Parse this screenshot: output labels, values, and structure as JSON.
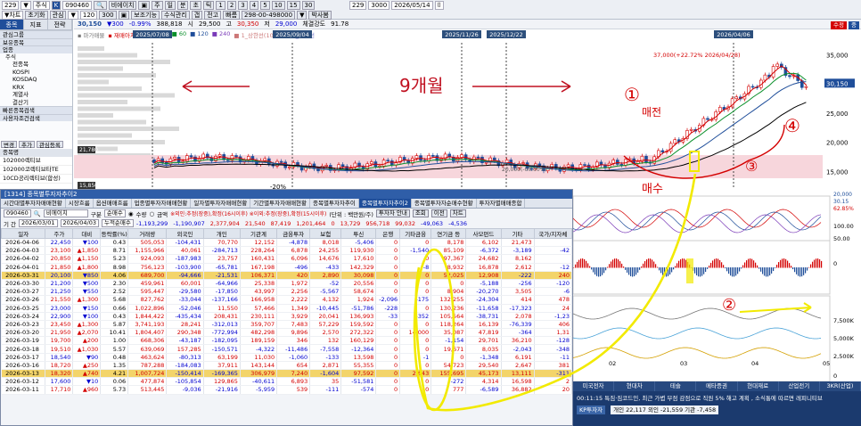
{
  "toolbar": {
    "row1": [
      "229",
      "▼",
      "주식",
      "K",
      "090460",
      "🔍",
      "비에이치",
      "▣",
      "주",
      "일",
      "분",
      "초",
      "틱",
      "1",
      "2",
      "3",
      "4",
      "5",
      "10",
      "15",
      "30"
    ],
    "row1b": [
      "229",
      "3000",
      "2026/05/14",
      "⌷"
    ],
    "row2": [
      "▼차트",
      "초기화",
      "관심",
      "▼",
      "120",
      "300",
      "▣",
      "보조기능",
      "수식관리",
      "갭",
      "전고",
      "빠름",
      "298-00-498000",
      "▼",
      "박사봄"
    ]
  },
  "sidebar": {
    "tabs": [
      "종목",
      "지표",
      "전략"
    ],
    "items": [
      {
        "label": "관심그룹",
        "type": "sect"
      },
      {
        "label": "보유종목",
        "type": "sect"
      },
      {
        "label": "업종",
        "type": "sect"
      },
      {
        "label": "주식",
        "type": "item"
      },
      {
        "label": "전종목",
        "type": "sub"
      },
      {
        "label": "KOSPI",
        "type": "sub"
      },
      {
        "label": "KOSDAQ",
        "type": "sub"
      },
      {
        "label": "KRX",
        "type": "sub"
      },
      {
        "label": "계열사",
        "type": "sub"
      },
      {
        "label": "결산기",
        "type": "sub"
      },
      {
        "label": "빠른종목검색",
        "type": "sect"
      },
      {
        "label": "사용자조건검색",
        "type": "sect"
      }
    ]
  },
  "stock_panel": {
    "buttons": [
      "변경",
      "추가",
      "관심등록"
    ],
    "header": "종목명",
    "items": [
      "102000렉티브",
      "102000코렉티브타TE",
      "10CD공리렉티브(합성)"
    ]
  },
  "chart_header": {
    "items": [
      "▪ 마가매물",
      "▪ 재매아치",
      "▣ 5",
      "■ 20",
      "■ 60",
      "■ 120",
      "■ 240",
      "■ 1_상한선(10.3)",
      "■ 1_하한선"
    ],
    "price": "30,150",
    "chg": "▼300",
    "pct": "-0.99%",
    "vol": "388,818",
    "hi_label": "고",
    "hi": "30,350",
    "lo_label": "저",
    "lo": "29,000",
    "amt_label": "체결강도",
    "amt": "91.78",
    "open_label": "시",
    "open": "29,500"
  },
  "chart_labels": {
    "dates": [
      "2025/07/08",
      "2025/09/04",
      "2025/11/26",
      "2025/12/22",
      "2026/04/06"
    ],
    "yaxis": [
      "35,000",
      "30,150",
      "25,000",
      "20,000",
      "15,000"
    ],
    "annot_top": "37,000(+22.72% 2026/04/28)",
    "annot_mid": "20,000(-00.00%)",
    "annot_left": "21,780",
    "annot_left2": "15,850",
    "annot_20": "-20%",
    "right_buttons": [
      "수정",
      "중"
    ]
  },
  "handwriting": {
    "months": "9개월",
    "n1": "①",
    "word1": "매전",
    "n4": "④",
    "n3": "③",
    "buy": "매수",
    "n2": "②"
  },
  "window": {
    "title": "[1314] 종목별투자자추이2",
    "tabs": [
      "시간대별투자자매매현황",
      "시장흐름",
      "옵션매매흐름",
      "업종별투자자매매현황",
      "일자별투자자매매현황",
      "기간별투자자매매현황",
      "종목별투자자추이",
      "종목별투자자추이2",
      "종목별투자자순매수현황",
      "투자자별매매종합"
    ],
    "ctrl1": {
      "code": "090460",
      "name": "비에이치",
      "kind_label": "구분",
      "kind": "순매수",
      "unit_toggle": "수량",
      "amount_toggle": "금액",
      "note": "※외인:추정(장중),확정(16시이후)  ※이외:추정(장중),확정(15시이후)",
      "unit_label": "(단위 : 백만원/주)",
      "btn1": "투자자 안내",
      "btn2": "조회",
      "btn3": "이전",
      "btn4": "차트"
    },
    "ctrl2": {
      "period_label": "기 간",
      "from": "2026/03/01",
      "to": "2026/04/03",
      "accum_label": "누적순매수",
      "sums": [
        "-1,193,299",
        "-1,190,907",
        "2,377,904",
        "21,540",
        "87,419",
        "1,201,464",
        "0",
        "13,729",
        "956,718",
        "99,032",
        "-49,063",
        "-4,536"
      ]
    },
    "columns": [
      "일자",
      "주가",
      "대비",
      "등락률(%)",
      "거래량",
      "외국인",
      "개인",
      "기관계",
      "금융투자",
      "보험",
      "투신",
      "은행",
      "기타금융",
      "연기금 등",
      "사모펀드",
      "기타",
      "국가/지자체"
    ],
    "rows": [
      [
        "2026-04-06",
        "22,450",
        "▼100",
        "0.43",
        "505,053",
        "-104,431",
        "70,770",
        "12,152",
        "-4,878",
        "8,018",
        "-5,406",
        "0",
        "0",
        "8,178",
        "6,102",
        "21,473",
        ""
      ],
      [
        "2026-04-03",
        "23,100",
        "▲1,850",
        "8.71",
        "1,155,966",
        "40,061",
        "-284,713",
        "228,264",
        "6,878",
        "24,255",
        "119,930",
        "0",
        "-1,540",
        "85,109",
        "-6,372",
        "-3,189",
        "-42"
      ],
      [
        "2026-04-02",
        "20,850",
        "▲1,150",
        "5.23",
        "924,093",
        "-187,983",
        "23,757",
        "160,431",
        "6,096",
        "14,676",
        "17,610",
        "0",
        "0",
        "97,367",
        "24,682",
        "8,162",
        ""
      ],
      [
        "2026-04-01",
        "21,850",
        "▲1,800",
        "8.98",
        "756,123",
        "-103,900",
        "-65,781",
        "167,198",
        "-496",
        "-433",
        "142,329",
        "0",
        "-8",
        "8,932",
        "16,878",
        "2,612",
        "-12"
      ],
      [
        "2026-03-31",
        "20,100",
        "▼850",
        "4.06",
        "689,700",
        "-94,666",
        "-21,531",
        "106,371",
        "420",
        "2,890",
        "30,098",
        "0",
        "0",
        "52,025",
        "12,908",
        "-222",
        "240"
      ],
      [
        "2026-03-30",
        "21,200",
        "▼500",
        "2.30",
        "459,961",
        "60,001",
        "-64,966",
        "25,338",
        "1,972",
        "-52",
        "20,556",
        "0",
        "0",
        "0",
        "-5,188",
        "-256",
        "-120"
      ],
      [
        "2026-03-27",
        "21,250",
        "▼550",
        "2.52",
        "595,447",
        "-29,580",
        "-17,850",
        "43,997",
        "2,256",
        "-5,567",
        "58,674",
        "0",
        "0",
        "8,904",
        "-20,270",
        "3,505",
        "-6"
      ],
      [
        "2026-03-26",
        "21,550",
        "▲1,300",
        "5.68",
        "827,762",
        "-33,044",
        "-137,166",
        "166,958",
        "2,222",
        "4,132",
        "1,924",
        "-2,096",
        "-175",
        "132,255",
        "-24,304",
        "414",
        "478"
      ],
      [
        "2026-03-25",
        "23,000",
        "▼150",
        "0.66",
        "1,022,896",
        "-52,046",
        "11,550",
        "57,466",
        "1,349",
        "-10,445",
        "-51,786",
        "-228",
        "0",
        "130,236",
        "-11,658",
        "-17,323",
        "24"
      ],
      [
        "2026-03-24",
        "22,900",
        "▼100",
        "0.43",
        "1,844,422",
        "-435,434",
        "208,431",
        "230,111",
        "3,929",
        "20,041",
        "136,993",
        "-33",
        "-352",
        "105,564",
        "-38,731",
        "2,078",
        "-1,23"
      ],
      [
        "2026-03-23",
        "23,450",
        "▲1,300",
        "5.87",
        "3,741,193",
        "28,241",
        "-312,013",
        "359,707",
        "7,483",
        "57,229",
        "159,592",
        "0",
        "0",
        "118,264",
        "16,139",
        "-76,339",
        "406"
      ],
      [
        "2026-03-20",
        "21,950",
        "▲2,070",
        "10.41",
        "1,804,407",
        "290,348",
        "-772,994",
        "482,298",
        "9,896",
        "2,570",
        "272,322",
        "0",
        "14,000",
        "35,087",
        "47,819",
        "-364",
        "1,31"
      ],
      [
        "2026-03-19",
        "19,700",
        "▲200",
        "1.00",
        "668,306",
        "-43,187",
        "-182,095",
        "189,159",
        "346",
        "132",
        "160,129",
        "0",
        "0",
        "-1,154",
        "29,701",
        "36,210",
        "-128"
      ],
      [
        "2026-03-18",
        "19,510",
        "▲1,030",
        "5.57",
        "639,069",
        "157,285",
        "-150,571",
        "-4,322",
        "-11,486",
        "-7,558",
        "-12,364",
        "0",
        "0",
        "19,671",
        "8,035",
        "-2,043",
        "-348"
      ],
      [
        "2026-03-17",
        "18,540",
        "▼90",
        "0.48",
        "463,624",
        "-80,313",
        "63,199",
        "11,030",
        "-1,060",
        "-133",
        "13,598",
        "0",
        "-1",
        "0",
        "-1,348",
        "6,191",
        "-11"
      ],
      [
        "2026-03-16",
        "18,720",
        "▲250",
        "1.35",
        "787,288",
        "-184,083",
        "37,911",
        "143,144",
        "654",
        "2,871",
        "55,355",
        "0",
        "0",
        "54,723",
        "29,540",
        "2,647",
        "381"
      ],
      [
        "2026-03-13",
        "18,320",
        "▲740",
        "4.21",
        "1,007,724",
        "-150,414",
        "-169,365",
        "306,979",
        "7,240",
        "-1,604",
        "97,592",
        "0",
        "2,643",
        "155,695",
        "45,173",
        "13,111",
        "-311"
      ],
      [
        "2026-03-12",
        "17,600",
        "▼10",
        "0.06",
        "477,874",
        "-105,854",
        "129,865",
        "-40,611",
        "6,893",
        "35",
        "-51,581",
        "0",
        "0",
        "-272",
        "4,314",
        "16,598",
        "2"
      ],
      [
        "2026-03-11",
        "17,710",
        "▲960",
        "5.73",
        "513,445",
        "-9,036",
        "-21,916",
        "-5,959",
        "539",
        "-111",
        "-574",
        "0",
        "0",
        "777",
        "-6,589",
        "36,882",
        "20"
      ]
    ],
    "sel_rows": [
      4,
      16
    ]
  },
  "right_panel": {
    "yaxis": [
      "100.00",
      "50.00",
      "0",
      "7,500K",
      "5,000K",
      "2,500K",
      "0"
    ],
    "xaxis": [
      "02",
      "03",
      "04",
      "05"
    ],
    "top_vals": [
      "20,000",
      "30.15",
      "62.85%"
    ]
  },
  "bottom": {
    "tabs": [
      "미국전자",
      "현대차",
      "테슬",
      "메타증권",
      "현대재료",
      "산업전기",
      "3KR(산업)"
    ],
    "news": "00:11:15  특짐·짐코드인, 최근 가볍 부점 감점으로 직원 5% 해고 계획 , 소식통에 따르면 레피니티브",
    "investor_label": "KP투자자",
    "investor": "개인 22,117  외인 -21,559  기관 -7,458"
  },
  "colors": {
    "up": "#d40000",
    "down": "#0000d0",
    "highlight": "#ffff00",
    "navy": "#1f4e9a"
  }
}
